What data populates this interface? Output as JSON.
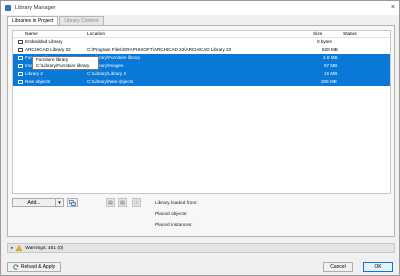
{
  "window": {
    "title": "Library Manager",
    "close_glyph": "×"
  },
  "tabs": [
    {
      "label": "Libraries in Project",
      "active": true
    },
    {
      "label": "Library Content",
      "active": false
    }
  ],
  "columns": {
    "name": "Name",
    "location": "Location",
    "size": "Size",
    "status": "Status"
  },
  "rows": [
    {
      "name": "Embedded Library",
      "location": "",
      "size": "0 bytes",
      "selected": false,
      "icon": "embedded-library-icon"
    },
    {
      "name": "ARCHICAD Library 22",
      "location": "C:\\Program Files\\GRAPHISOFT\\ARCHICAD 22\\ARCHICAD Library 22",
      "size": "628 MB",
      "selected": false,
      "icon": "folder-icon"
    },
    {
      "name": "Furniture library",
      "location": "C:\\Library\\Furniture library",
      "size": "2.8 MB",
      "selected": true,
      "icon": "folder-icon"
    },
    {
      "name": "Images",
      "location": "C:\\Library\\Images",
      "size": "57 MB",
      "selected": true,
      "icon": "folder-icon"
    },
    {
      "name": "Library 2",
      "location": "C:\\Library\\Library 2",
      "size": "15 MB",
      "selected": true,
      "icon": "folder-icon"
    },
    {
      "name": "New objects",
      "location": "C:\\Library\\New objects",
      "size": "206 MB",
      "selected": true,
      "icon": "folder-icon"
    }
  ],
  "tooltip": {
    "line1": "Furniture library",
    "line2": "C:\\Library\\Furniture library"
  },
  "controls": {
    "add_label": "Add...",
    "add_caret": "▾"
  },
  "info": {
    "loaded_from": "Library loaded from:",
    "placed_objects": "Placed objects:",
    "placed_instances": "Placed instances:"
  },
  "warnings": {
    "label": "Warnings: 451 (0)"
  },
  "footer": {
    "reload_label": "Reload & Apply",
    "cancel_label": "Cancel",
    "ok_label": "OK"
  },
  "colors": {
    "selection": "#0a78d7",
    "warning": "#f4b400",
    "ok_border": "#0a78d7"
  }
}
